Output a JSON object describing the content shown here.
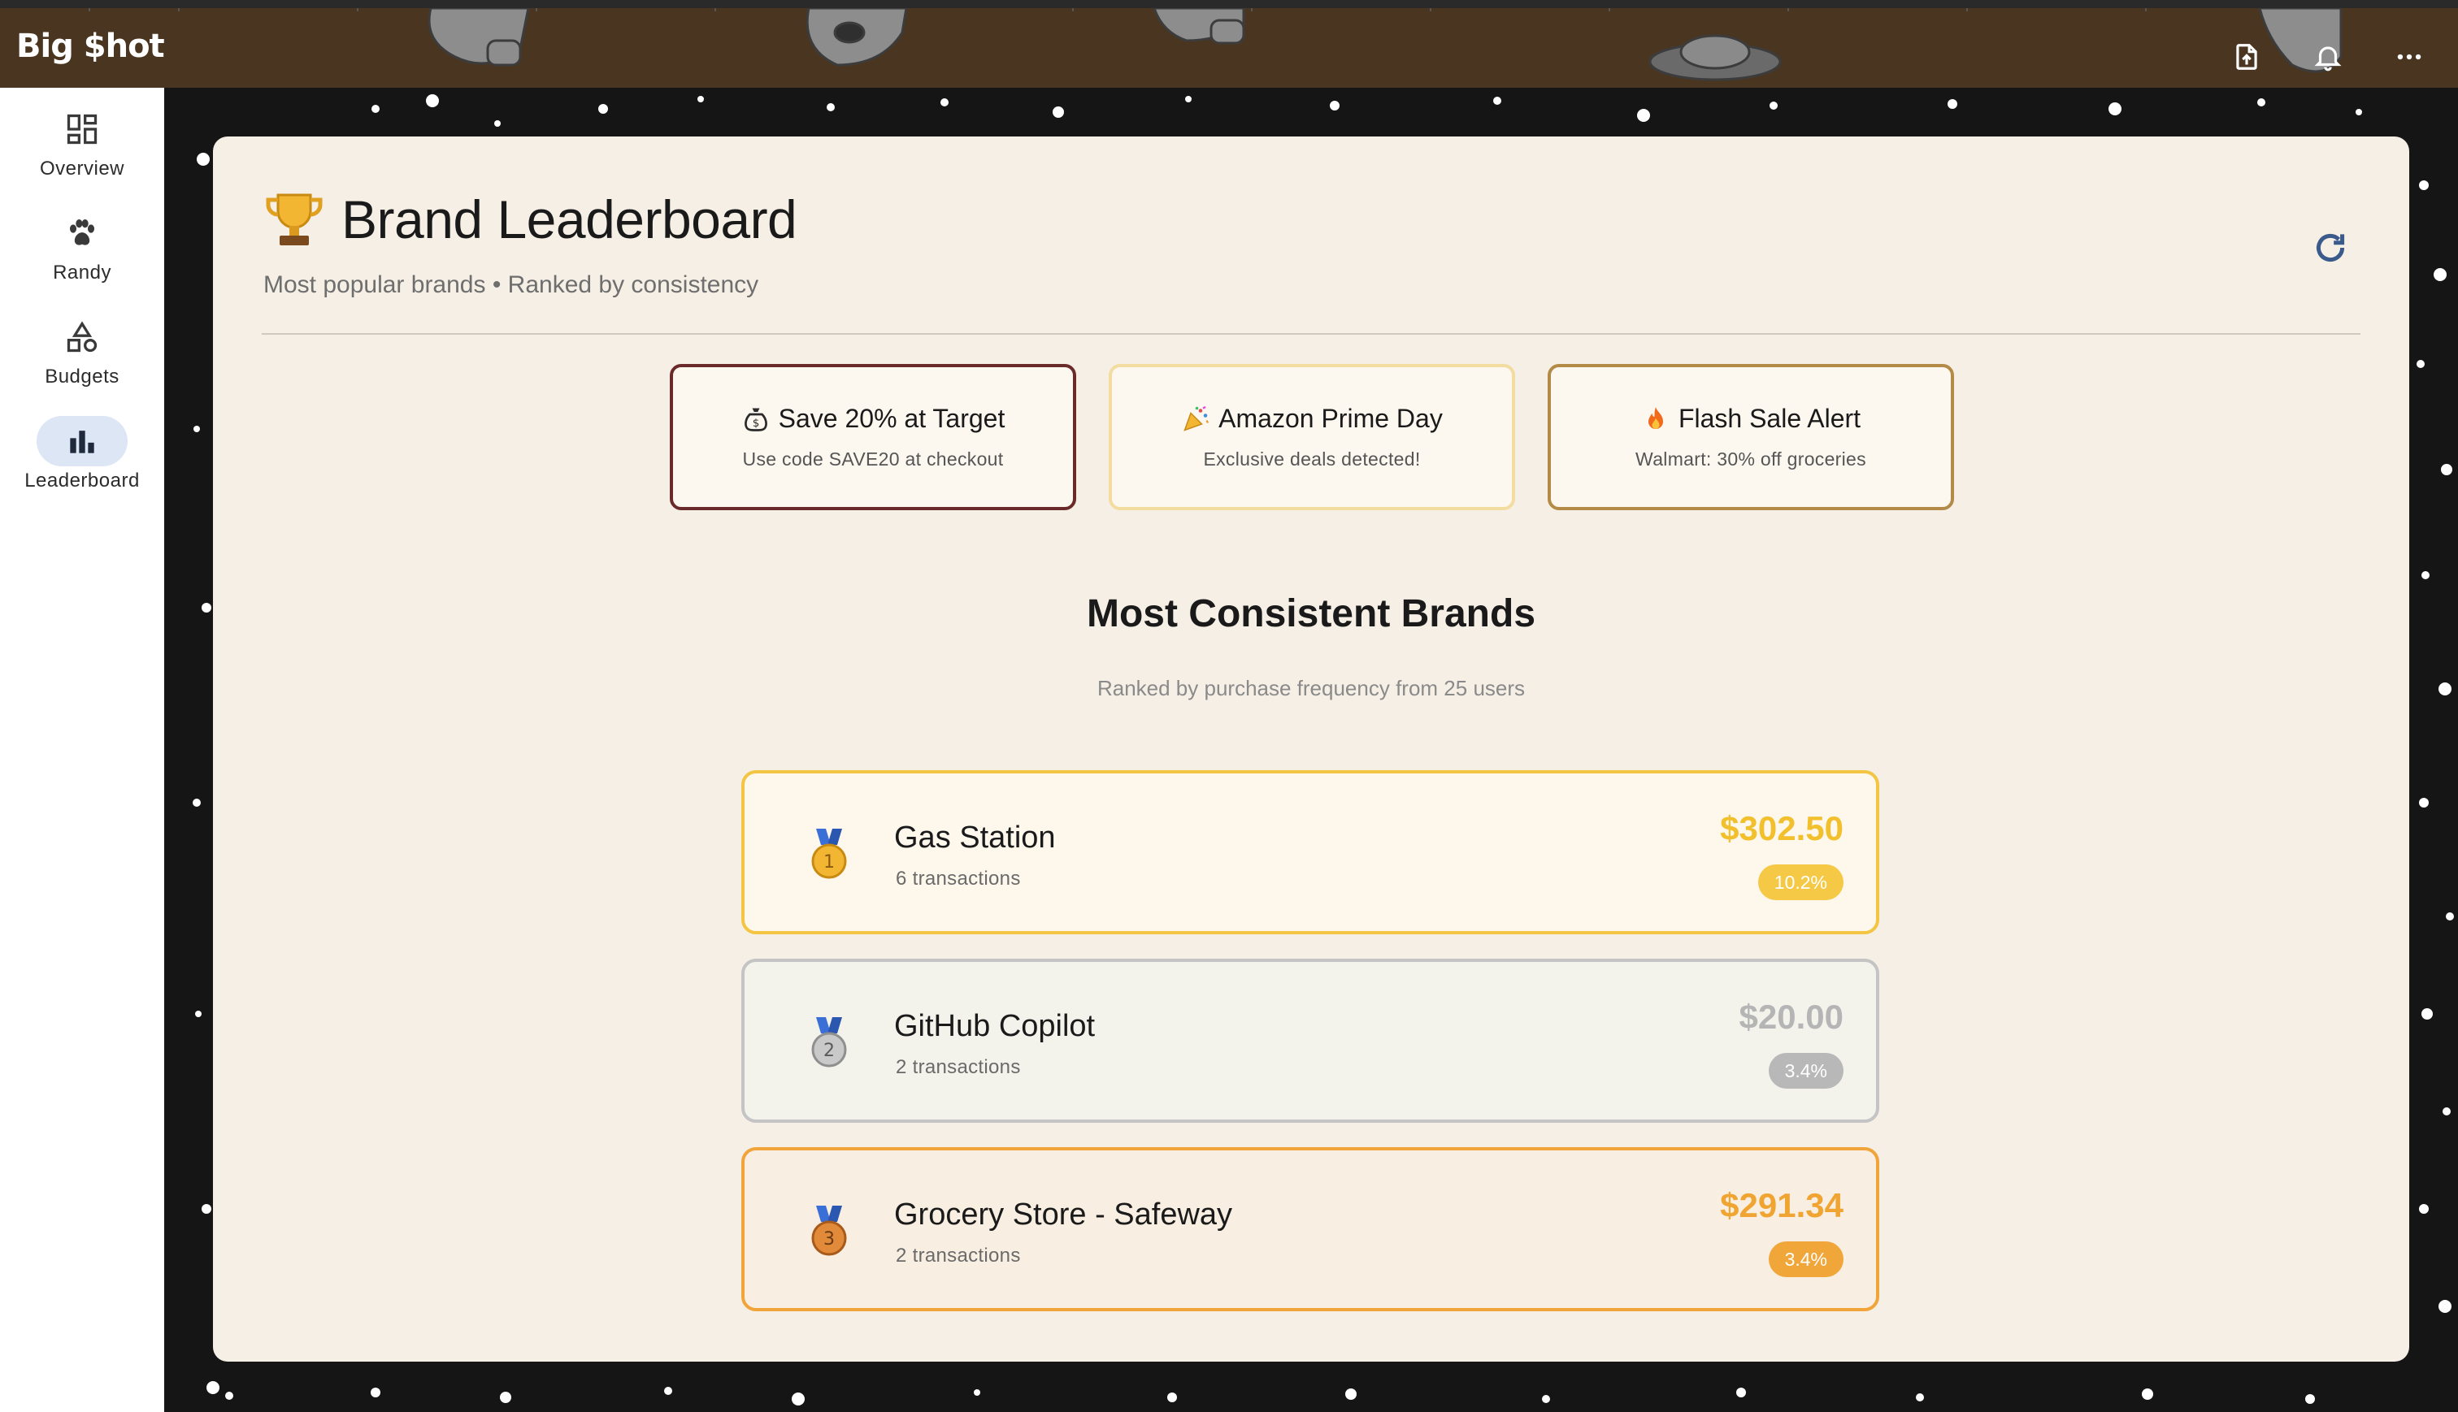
{
  "app": {
    "title": "Big $hot"
  },
  "topbar": {
    "actions": [
      {
        "name": "export-icon"
      },
      {
        "name": "bell-icon"
      },
      {
        "name": "more-horizontal-icon"
      }
    ]
  },
  "nav": {
    "items": [
      {
        "label": "Overview",
        "icon": "dashboard-icon",
        "active": false
      },
      {
        "label": "Randy",
        "icon": "paw-icon",
        "active": false
      },
      {
        "label": "Budgets",
        "icon": "shapes-icon",
        "active": false
      },
      {
        "label": "Leaderboard",
        "icon": "bar-chart-icon",
        "active": true
      }
    ]
  },
  "page": {
    "title": "Brand Leaderboard",
    "subtitle": "Most popular brands • Ranked by consistency"
  },
  "promos": [
    {
      "title": "Save 20% at Target",
      "subtitle": "Use code SAVE20 at checkout",
      "icon": "money-bag-icon"
    },
    {
      "title": "Amazon Prime Day",
      "subtitle": "Exclusive deals detected!",
      "icon": "party-popper-icon"
    },
    {
      "title": "Flash Sale Alert",
      "subtitle": "Walmart: 30% off groceries",
      "icon": "fire-icon"
    }
  ],
  "leaderboard": {
    "title": "Most Consistent Brands",
    "subtitle": "Ranked by purchase frequency from 25 users",
    "rows": [
      {
        "rank": "1",
        "name": "Gas Station",
        "transactions": "6 transactions",
        "amount": "$302.50",
        "share": "10.2%",
        "color": "#f4c542"
      },
      {
        "rank": "2",
        "name": "GitHub Copilot",
        "transactions": "2 transactions",
        "amount": "$20.00",
        "share": "3.4%",
        "color": "#b8b8b8"
      },
      {
        "rank": "3",
        "name": "Grocery Store - Safeway",
        "transactions": "2 transactions",
        "amount": "$291.34",
        "share": "3.4%",
        "color": "#f0a43a"
      }
    ]
  },
  "colors": {
    "appbar": "#4a3620",
    "card": "#f6efe6",
    "accent": "#3b5a8c"
  }
}
